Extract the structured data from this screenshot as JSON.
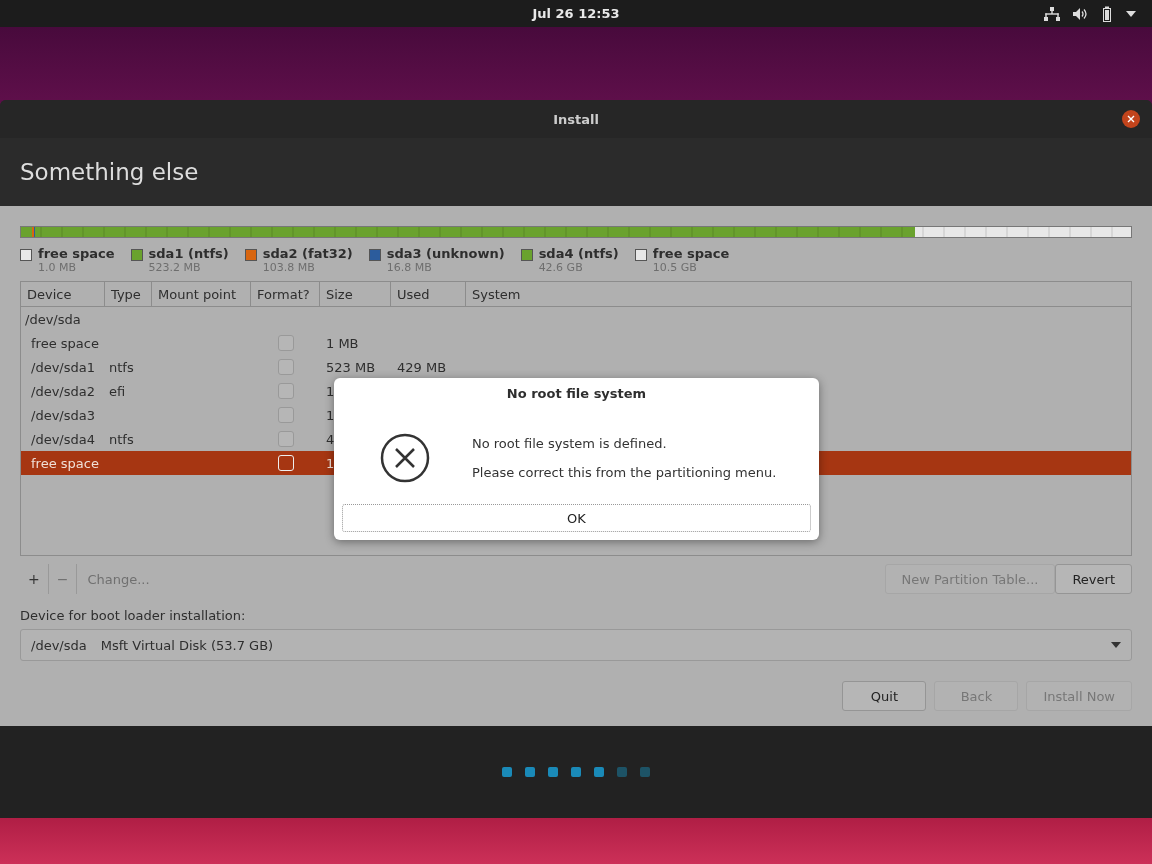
{
  "top_bar": {
    "clock": "Jul 26  12:53"
  },
  "window": {
    "title": "Install",
    "heading": "Something else"
  },
  "partitions": [
    {
      "name": "free space",
      "size": "1.0 MB",
      "color": "#e8e8e8"
    },
    {
      "name": "sda1 (ntfs)",
      "size": "523.2 MB",
      "color": "#6aa22e"
    },
    {
      "name": "sda2 (fat32)",
      "size": "103.8 MB",
      "color": "#d8650f"
    },
    {
      "name": "sda3 (unknown)",
      "size": "16.8 MB",
      "color": "#2c5c9c"
    },
    {
      "name": "sda4 (ntfs)",
      "size": "42.6 GB",
      "color": "#6aa22e"
    },
    {
      "name": "free space",
      "size": "10.5 GB",
      "color": "#e8e8e8"
    }
  ],
  "table": {
    "columns": [
      "Device",
      "Type",
      "Mount point",
      "Format?",
      "Size",
      "Used",
      "System"
    ],
    "rows": [
      {
        "kind": "disk",
        "device": "/dev/sda",
        "selected": false
      },
      {
        "kind": "partition",
        "device": "free space",
        "type": "",
        "format": false,
        "size": "1 MB",
        "used": "",
        "selected": false
      },
      {
        "kind": "partition",
        "device": "/dev/sda1",
        "type": "ntfs",
        "format": false,
        "size": "523 MB",
        "used": "429 MB",
        "selected": false
      },
      {
        "kind": "partition",
        "device": "/dev/sda2",
        "type": "efi",
        "format": false,
        "size": "1",
        "used": "",
        "selected": false
      },
      {
        "kind": "partition",
        "device": "/dev/sda3",
        "type": "",
        "format": false,
        "size": "1",
        "used": "",
        "selected": false
      },
      {
        "kind": "partition",
        "device": "/dev/sda4",
        "type": "ntfs",
        "format": false,
        "size": "4",
        "used": "",
        "selected": false
      },
      {
        "kind": "partition",
        "device": "free space",
        "type": "",
        "format": false,
        "size": "1",
        "used": "",
        "selected": true
      }
    ]
  },
  "toolbar": {
    "add": "+",
    "remove": "−",
    "change": "Change...",
    "new_table": "New Partition Table...",
    "revert": "Revert"
  },
  "boot_loader": {
    "label": "Device for boot loader installation:",
    "device": "/dev/sda",
    "disk": "Msft Virtual Disk (53.7 GB)"
  },
  "buttons": [
    {
      "label": "Quit",
      "disabled": false
    },
    {
      "label": "Back",
      "disabled": true
    },
    {
      "label": "Install Now",
      "disabled": true
    }
  ],
  "steps": [
    {
      "done": true
    },
    {
      "done": true
    },
    {
      "done": true
    },
    {
      "done": true
    },
    {
      "done": true
    },
    {
      "done": false
    },
    {
      "done": false
    }
  ],
  "dialog": {
    "title": "No root file system",
    "message": "No root file system is defined.",
    "detail": "Please correct this from the partitioning menu.",
    "button": "OK"
  }
}
